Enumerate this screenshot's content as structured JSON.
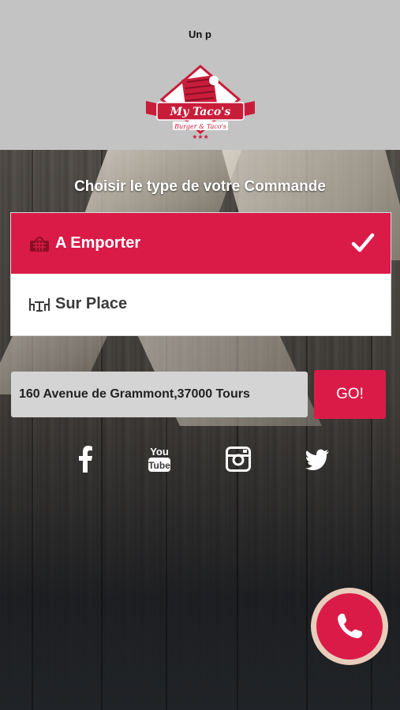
{
  "header": {
    "top_text": "Un p",
    "logo": {
      "name": "My Taco's",
      "tagline": "Burger & Taco's",
      "icon": "taco-logo"
    }
  },
  "order_type": {
    "title": "Choisir le type de votre Commande",
    "options": [
      {
        "label": "A Emporter",
        "icon": "basket-icon",
        "selected": true
      },
      {
        "label": "Sur Place",
        "icon": "table-chairs-icon",
        "selected": false
      }
    ]
  },
  "address": {
    "value": "160 Avenue de Grammont,37000 Tours",
    "go_label": "GO!"
  },
  "social": [
    "facebook-icon",
    "youtube-icon",
    "instagram-icon",
    "twitter-icon"
  ],
  "colors": {
    "accent": "#da1b48",
    "header_bg": "#c3c3c3"
  }
}
